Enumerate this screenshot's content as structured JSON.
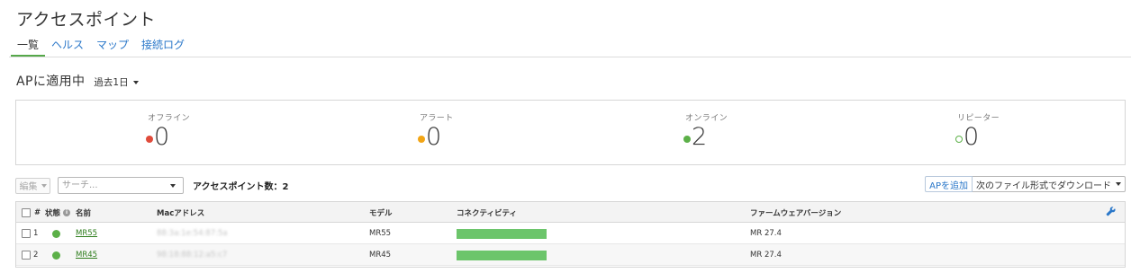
{
  "page": {
    "title": "アクセスポイント"
  },
  "tabs": [
    {
      "label": "一覧",
      "active": true
    },
    {
      "label": "ヘルス",
      "active": false
    },
    {
      "label": "マップ",
      "active": false
    },
    {
      "label": "接続ログ",
      "active": false
    }
  ],
  "filter": {
    "label": "APに適用中",
    "range": "過去1日"
  },
  "summary": {
    "offline": {
      "label": "オフライン",
      "value": "0",
      "color": "#e04b3b"
    },
    "alerting": {
      "label": "アラート",
      "value": "0",
      "color": "#f2a515"
    },
    "online": {
      "label": "オンライン",
      "value": "2",
      "color": "#5cb048"
    },
    "repeater": {
      "label": "リピーター",
      "value": "0",
      "color": "#5cb048"
    }
  },
  "toolbar": {
    "edit_label": "編集",
    "search_placeholder": "サーチ...",
    "ap_count": "アクセスポイント数：2",
    "add_ap_label": "APを追加",
    "download_label": "次のファイル形式でダウンロード"
  },
  "table": {
    "headers": {
      "index": "#",
      "status": "状態",
      "name": "名前",
      "mac": "Macアドレス",
      "model": "モデル",
      "connectivity": "コネクティビティ",
      "firmware": "ファームウェアバージョン"
    },
    "rows": [
      {
        "index": "1",
        "status_color": "#5cb048",
        "name": "MR55",
        "mac": "88:3a:1e:54:87:5a",
        "model": "MR55",
        "connectivity_color": "#6cc56b",
        "connectivity_uptime": 1.0,
        "firmware": "MR 27.4"
      },
      {
        "index": "2",
        "status_color": "#5cb048",
        "name": "MR45",
        "mac": "98:18:88:12:a5:c7",
        "model": "MR45",
        "connectivity_color": "#6cc56b",
        "connectivity_uptime": 1.0,
        "firmware": "MR 27.4"
      }
    ]
  },
  "icons": {
    "caret": "caret-down-icon",
    "info": "info-icon",
    "wrench": "wrench-icon"
  }
}
